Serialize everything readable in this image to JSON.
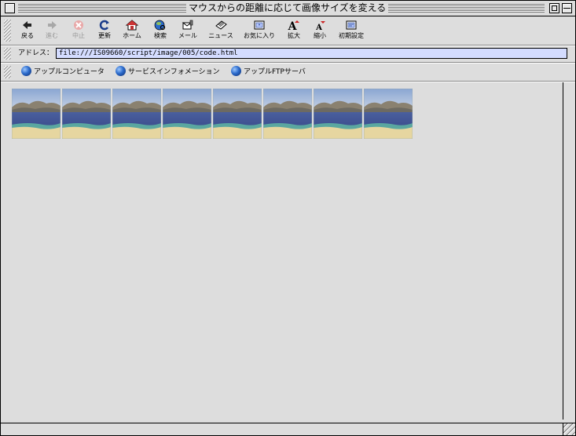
{
  "window": {
    "title": "マウスからの距離に応じて画像サイズを変える"
  },
  "toolbar": {
    "buttons": [
      {
        "label": "戻る",
        "icon": "back-arrow-icon"
      },
      {
        "label": "進む",
        "icon": "forward-arrow-icon",
        "state": "disabled"
      },
      {
        "label": "中止",
        "icon": "stop-icon",
        "state": "disabled"
      },
      {
        "label": "更新",
        "icon": "refresh-icon"
      },
      {
        "label": "ホーム",
        "icon": "home-icon"
      },
      {
        "label": "検索",
        "icon": "search-globe-icon"
      },
      {
        "label": "メール",
        "icon": "mail-icon"
      },
      {
        "label": "ニュース",
        "icon": "news-icon"
      },
      {
        "label": "お気に入り",
        "icon": "favorites-icon"
      },
      {
        "label": "拡大",
        "icon": "text-larger-icon"
      },
      {
        "label": "縮小",
        "icon": "text-smaller-icon"
      },
      {
        "label": "初期設定",
        "icon": "preferences-icon"
      }
    ]
  },
  "address": {
    "label": "アドレス：",
    "url": "file:///IS09660/script/image/005/code.html"
  },
  "favorites": {
    "items": [
      {
        "label": "アップルコンピュータ"
      },
      {
        "label": "サービスインフォメーション"
      },
      {
        "label": "アップルFTPサーバ"
      }
    ]
  },
  "content": {
    "image_description": "beach landscape thumbnail",
    "thumbnail_count": 8
  },
  "colors": {
    "chrome": "#dddddd",
    "address_field": "#d4dcff",
    "sky": "#9fb4d6",
    "sea": "#3d4f8f",
    "sand": "#e6d6a0"
  }
}
